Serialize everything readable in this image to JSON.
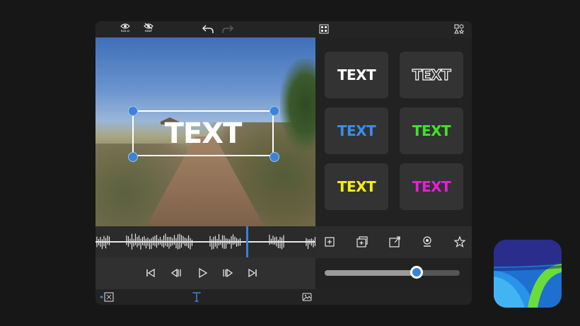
{
  "topbar": {
    "solo_label": "SOLO",
    "hide_label": "HIDE",
    "icons": [
      "eye-icon",
      "eye-slash-icon",
      "undo-icon",
      "redo-icon",
      "grid-icon",
      "shapes-icon"
    ]
  },
  "preview": {
    "overlay_text": "TEXT",
    "handle_color": "#3d82d6"
  },
  "timeline": {
    "playhead_color": "#3b82d6"
  },
  "transport": {
    "icons": [
      "skip-start-icon",
      "step-back-icon",
      "play-icon",
      "step-forward-icon",
      "skip-end-icon"
    ]
  },
  "bottombar": {
    "icons": [
      "fit-frame-icon",
      "text-tool-icon",
      "image-icon"
    ]
  },
  "styles": {
    "items": [
      {
        "label": "TEXT",
        "variant": "solid",
        "color": "#ffffff"
      },
      {
        "label": "TEXT",
        "variant": "outline",
        "color": "#ffffff"
      },
      {
        "label": "TEXT",
        "variant": "solid",
        "color": "#3a8ee8"
      },
      {
        "label": "TEXT",
        "variant": "solid",
        "color": "#44e12a"
      },
      {
        "label": "TEXT",
        "variant": "solid",
        "color": "#f5ef12"
      },
      {
        "label": "TEXT",
        "variant": "solid",
        "color": "#e91ed8"
      }
    ]
  },
  "tools": {
    "icons": [
      "add-icon",
      "add-layer-icon",
      "export-frame-icon",
      "record-icon",
      "favorite-star-icon"
    ]
  },
  "slider": {
    "value": 0.68,
    "accent": "#3b82d6"
  }
}
